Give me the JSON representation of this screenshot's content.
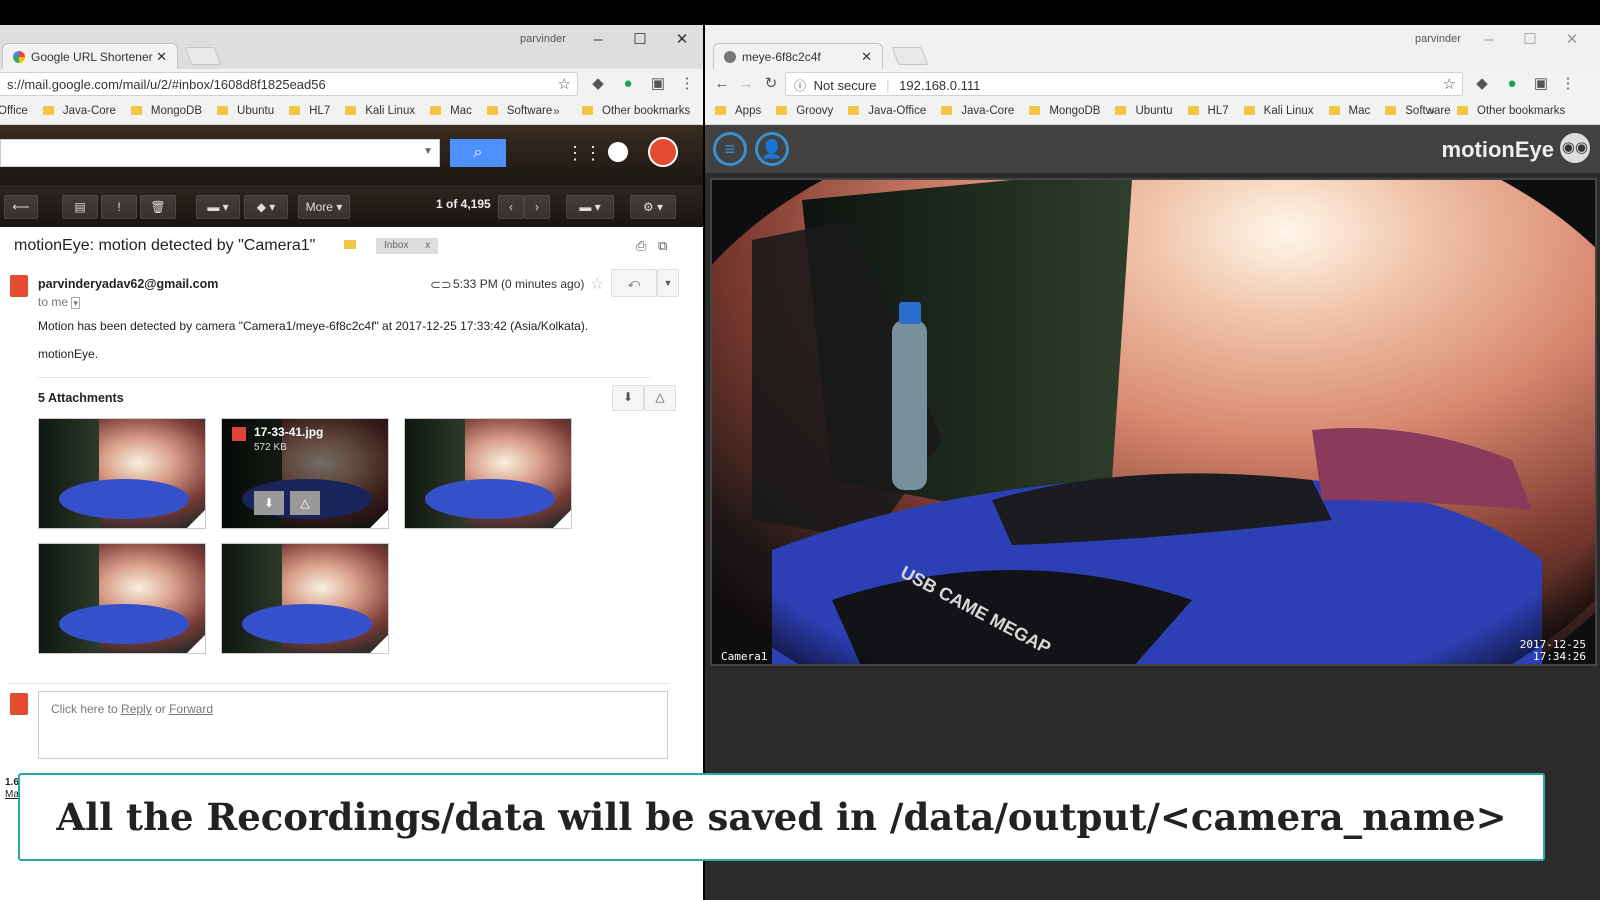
{
  "left_window": {
    "tab_title": "Google URL Shortener",
    "user": "parvinder",
    "url": "s://mail.google.com/mail/u/2/#inbox/1608d8f1825ead56",
    "bookmarks": [
      "Office",
      "Java-Core",
      "MongoDB",
      "Ubuntu",
      "HL7",
      "Kali Linux",
      "Mac",
      "Software"
    ],
    "bookmarks_more": "»",
    "other_bookmarks": "Other bookmarks"
  },
  "gmail": {
    "more_label": "More",
    "pagination": "1 of 4,195",
    "subject": "motionEye: motion detected by \"Camera1\"",
    "label_chip": "Inbox",
    "label_chip_close": "x",
    "sender": "parvinderyadav62@gmail.com",
    "to": "to me",
    "time": "5:33 PM (0 minutes ago)",
    "body_line1": "Motion has been detected by camera \"Camera1/meye-6f8c2c4f\" at 2017-12-25 17:33:42 (Asia/Kolkata).",
    "body_line2": "motionEye.",
    "attachments_label": "5 Attachments",
    "attachment_hover": {
      "name": "17-33-41.jpg",
      "size": "572 KB"
    },
    "reply_prompt": "Click here to",
    "reply_link": "Reply",
    "reply_or": "or",
    "forward_link": "Forward",
    "footer_fragment_1": "1.6",
    "footer_fragment_2": "Ma"
  },
  "right_window": {
    "tab_title": "meye-6f8c2c4f",
    "user": "parvinder",
    "not_secure": "Not secure",
    "url": "192.168.0.111",
    "bookmarks": [
      "Apps",
      "Groovy",
      "Java-Office",
      "Java-Core",
      "MongoDB",
      "Ubuntu",
      "HL7",
      "Kali Linux",
      "Mac",
      "Software"
    ],
    "bookmarks_more": "»",
    "other_bookmarks": "Other bookmarks"
  },
  "motioneye": {
    "logo": "motionEye",
    "camera_name": "Camera1",
    "date": "2017-12-25",
    "time": "17:34:26",
    "camera_sticker": "USB CAME MEGAP"
  },
  "caption": "All the Recordings/data will be saved in /data/output/<camera_name>",
  "colors": {
    "accent_blue": "#4d90fe",
    "motioneye_blue": "#3a8fd0",
    "caption_border": "#2aa7a8"
  }
}
